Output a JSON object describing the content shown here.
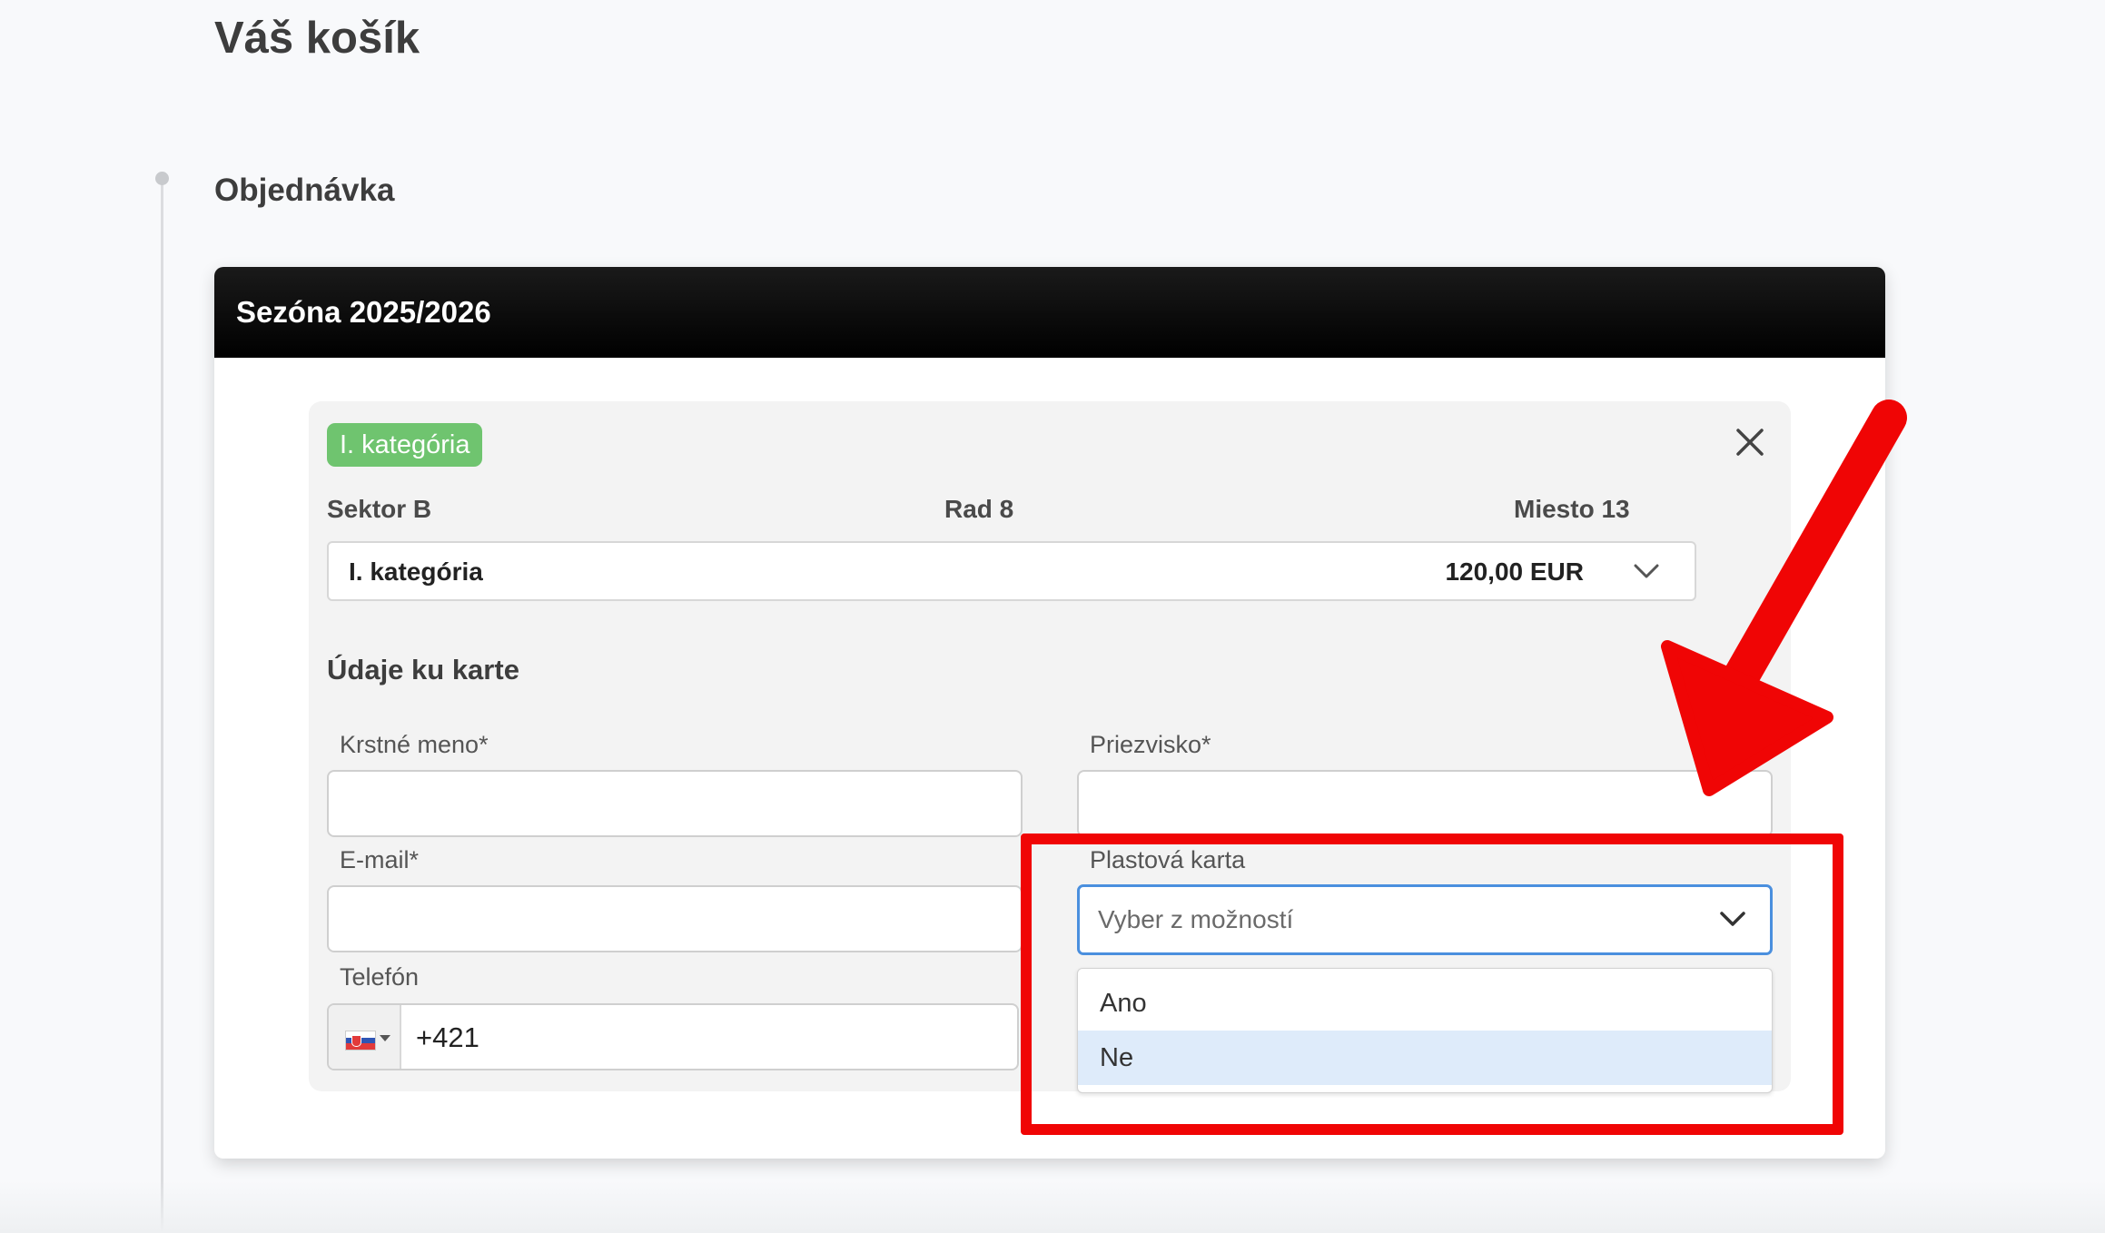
{
  "page": {
    "title": "Váš košík",
    "section_title": "Objednávka"
  },
  "season": {
    "header": "Sezóna 2025/2026"
  },
  "ticket": {
    "badge": "I. kategória",
    "sector": "Sektor B",
    "row": "Rad 8",
    "seat": "Miesto 13",
    "category_select": {
      "value": "I. kategória",
      "price": "120,00 EUR"
    },
    "card_details_title": "Údaje ku karte",
    "fields": {
      "first_name_label": "Krstné meno*",
      "first_name_value": "",
      "last_name_label": "Priezvisko*",
      "last_name_value": "",
      "email_label": "E-mail*",
      "email_value": "",
      "phone_label": "Telefón",
      "phone_value": "+421",
      "phone_country_flag": "Slovakia",
      "plastic_card_label": "Plastová karta",
      "plastic_card_placeholder": "Vyber z možností",
      "plastic_card_options": [
        "Ano",
        "Ne"
      ],
      "plastic_card_highlighted_option": "Ne"
    }
  },
  "colors": {
    "badge_green": "#6fc46f",
    "header_black": "#000000",
    "focus_blue": "#4a8fde",
    "option_highlight": "#deebfa",
    "annotation_red": "#f00505"
  },
  "icons": {
    "close": "close-icon",
    "chevron": "chevron-down-icon",
    "flag": "slovakia-flag-icon"
  }
}
